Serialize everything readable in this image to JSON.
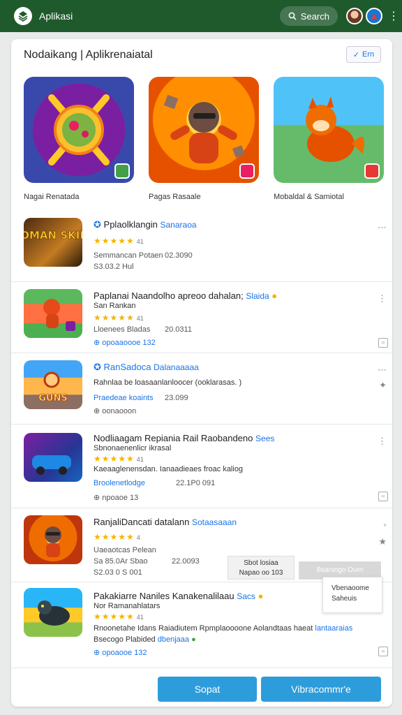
{
  "topbar": {
    "title": "Aplikasi",
    "search_label": "Search"
  },
  "card": {
    "title": "Nodaikang | Aplikrenaiatal",
    "filter_label": "Ern"
  },
  "featured": [
    {
      "caption": "Nagai Renatada"
    },
    {
      "caption": "Pagas Rasaale"
    },
    {
      "caption": "Mobaldal & Samiotal"
    }
  ],
  "rows": [
    {
      "name": "Pplaolklangin",
      "tag": "Sanaraoa",
      "rating": "★★★★★",
      "rating_count": "41",
      "line1_label": "Semmancan Potaen",
      "line1_value": "02.3090",
      "line2_label": "S3.03.2 Hul",
      "thumb_text": "MOMAN SKINS"
    },
    {
      "name": "Paplanai Naandolho apreoo dahalan;",
      "tag": "Slaida",
      "sub": "San Rankan",
      "rating": "★★★★★",
      "rating_count": "41",
      "line1_label": "Lloenees Bladas",
      "line1_value": "20.0311",
      "line2_label": "opoaaoooe 132"
    },
    {
      "name": "RanSadoca",
      "tag": "Dalanaaaaa",
      "sub": "Rahnlaa be loasaanlanloocer (ooklarasas. )",
      "line1_label": "Praedeae koaints",
      "line1_value": "23.099",
      "line2_label": "oonaooon",
      "thumb_text": "GUNS"
    },
    {
      "name": "Nodliaagam Repiania Rail Raobandeno",
      "tag": "Sees",
      "sub": "Sbnonaenenlicr ikrasal",
      "rating": "★★★★★",
      "rating_count": "41",
      "line1_label": "Kaeaaglenensdan. Ianaadieaes froac kaliog",
      "line2_label": "Broolenetlodge",
      "line2_value": "22.1P0 091",
      "line3_label": "npoaoe 13"
    },
    {
      "name": "RanjaliDancati datalann",
      "tag": "Sotaasaaan",
      "rating": "★★★★★",
      "rating_count": "4",
      "line1_label": "Uaeaotcas Pelean",
      "line2_label": "Sa 85.0Ar Sbao",
      "line2_value": "22.0093",
      "line3_label": "S2.03 0 S 001"
    },
    {
      "name": "Pakakiarre Naniles Kanakenalilaau",
      "tag": "Sacs",
      "sub": "Nor Ramanahlatars",
      "rating": "★★★★★",
      "rating_count": "41",
      "line1_label": "Rnoonetahe Idans Raiadiutem Rpmplaoooone Aolandtaas haeat",
      "line1_link": "lantaaraias",
      "line2_label": "Bsecogo Plabided",
      "line2_link": "dbenjaaa",
      "line3_label": "opoaooe 132"
    }
  ],
  "popover": {
    "line1": "Sbot losiaa",
    "line2": "Napao oo 103",
    "button": "Bsaningo Ourn"
  },
  "menu": {
    "item1": "Vbenaoome",
    "item2": "Saheuis"
  },
  "footer": {
    "btn1": "Sopat",
    "btn2": "Vibracommr'e"
  },
  "colors": {
    "topbar": "#1f5a2c",
    "accent": "#2d9cdb",
    "star": "#f5b400",
    "link": "#1a73e8"
  }
}
